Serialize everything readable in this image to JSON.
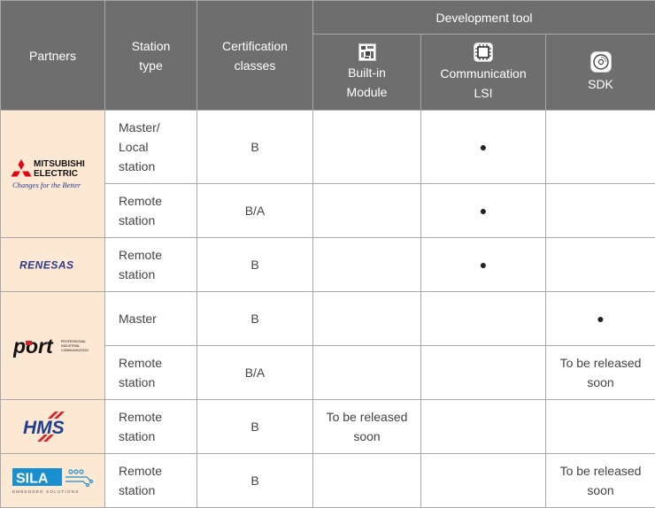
{
  "header": {
    "partners": "Partners",
    "station_type": "Station type",
    "certification": "Certification classes",
    "development_tool": "Development tool",
    "built_in": "Built-in Module",
    "comm_lsi": "Communication LSI",
    "sdk": "SDK",
    "icons": {
      "built_in": "module-icon",
      "comm_lsi": "chip-icon",
      "sdk": "disc-icon"
    }
  },
  "partners": [
    {
      "logo": {
        "name": "mitsubishi-electric-logo",
        "line1": "MITSUBISHI",
        "line2": "ELECTRIC",
        "tagline": "Changes for the Better"
      },
      "rows": [
        {
          "station": "Master/ Local station",
          "cert": "B",
          "built_in": "",
          "comm_lsi": "●",
          "sdk": ""
        },
        {
          "station": "Remote station",
          "cert": "B/A",
          "built_in": "",
          "comm_lsi": "●",
          "sdk": ""
        }
      ]
    },
    {
      "logo": {
        "name": "renesas-logo",
        "text": "RENESAS"
      },
      "rows": [
        {
          "station": "Remote station",
          "cert": "B",
          "built_in": "",
          "comm_lsi": "●",
          "sdk": ""
        }
      ]
    },
    {
      "logo": {
        "name": "port-logo",
        "text": "port",
        "line1": "PROFESSIONAL",
        "line2": "INDUSTRIAL",
        "line3": "COMMUNICATION"
      },
      "rows": [
        {
          "station": "Master",
          "cert": "B",
          "built_in": "",
          "comm_lsi": "",
          "sdk": "●"
        },
        {
          "station": "Remote station",
          "cert": "B/A",
          "built_in": "",
          "comm_lsi": "",
          "sdk": "To be released soon"
        }
      ]
    },
    {
      "logo": {
        "name": "hms-logo",
        "text": "HMS"
      },
      "rows": [
        {
          "station": "Remote station",
          "cert": "B",
          "built_in": "To be released soon",
          "comm_lsi": "",
          "sdk": ""
        }
      ]
    },
    {
      "logo": {
        "name": "sila-logo",
        "text": "SILA",
        "tagline": "EMBEDDED SOLUTIONS"
      },
      "rows": [
        {
          "station": "Remote station",
          "cert": "B",
          "built_in": "",
          "comm_lsi": "",
          "sdk": "To be released soon"
        }
      ]
    }
  ],
  "colors": {
    "header_bg": "#6e6e6e",
    "logo_bg": "#fde8d4",
    "mitsubishi_red": "#e60012",
    "renesas_blue": "#2a3a8c",
    "hms_blue": "#1d3f8f",
    "hms_red": "#d8232a",
    "sila_blue": "#1a8fd0"
  }
}
